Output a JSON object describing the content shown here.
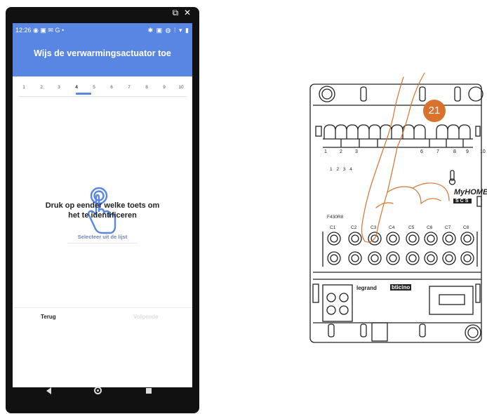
{
  "phone": {
    "status": {
      "time": "12:26",
      "left_icons": "◉ ▣ ✉ G •",
      "right_icons": "✱ ▣ ◍ ⁞ ▾ ▮"
    },
    "window_icons": "⧉ ✕",
    "header_title": "Wijs de verwarmingsactuator toe",
    "steps": [
      "1",
      "2",
      "3",
      "4",
      "5",
      "6",
      "7",
      "8",
      "9",
      "10"
    ],
    "active_step": 4,
    "prompt_line1": "Druk op eender welke toets om",
    "prompt_line2": "het te identificeren",
    "select_link": "Selecteer uit de lijst",
    "back_label": "Terug",
    "next_label": "Volgende",
    "accent_color": "#5a86e3",
    "touch_icon": "touch-hand-icon",
    "nav_icons": [
      "back-triangle-icon",
      "home-circle-icon",
      "recent-square-icon"
    ]
  },
  "device": {
    "badge": "21",
    "badge_color": "#d8722c",
    "top_numbers": [
      "1",
      "2",
      "3",
      "6",
      "7",
      "8",
      "9",
      "10"
    ],
    "small_numbers": "1 2 3 4",
    "model": "F430R8",
    "brand": "MyHOME",
    "brand_sub": "SCS",
    "channels": [
      "C1",
      "C2",
      "C3",
      "C4",
      "C5",
      "C6",
      "C7",
      "C8"
    ],
    "logo_left": "legrand",
    "logo_right": "bticino"
  }
}
